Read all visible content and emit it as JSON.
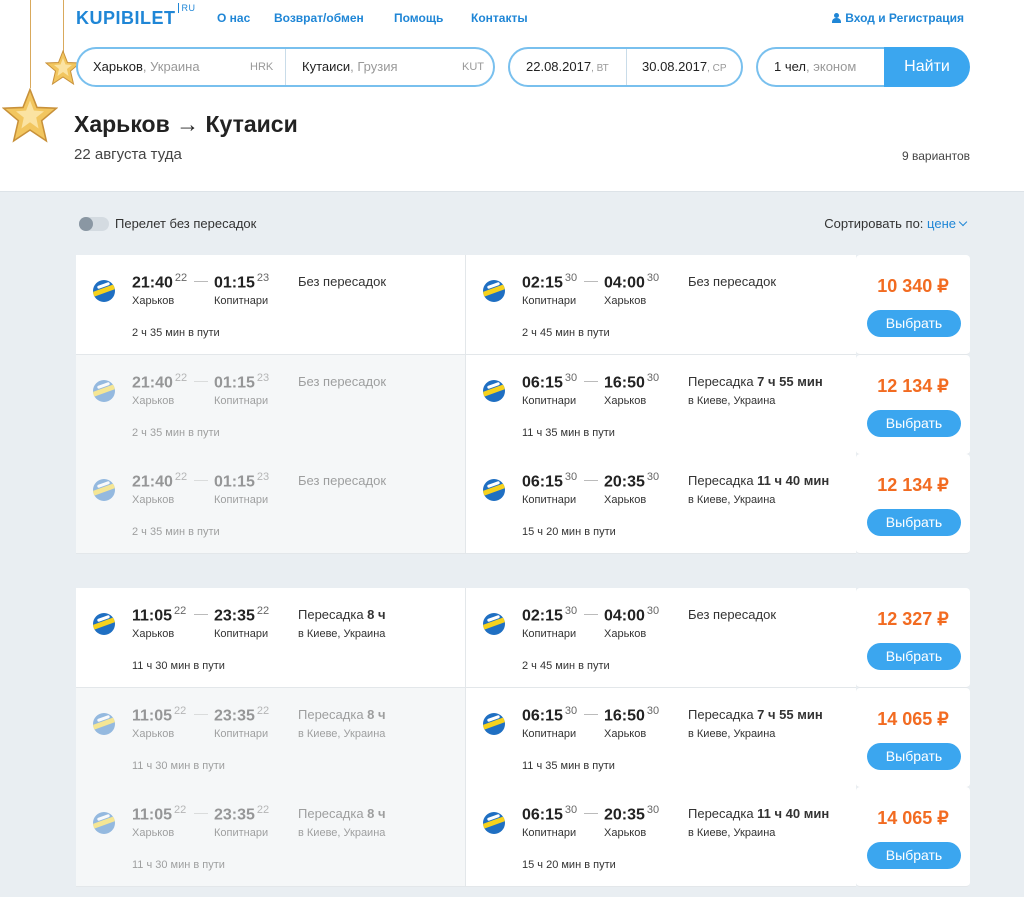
{
  "header": {
    "logo": "KUPIBILET",
    "logo_suffix": "RU",
    "nav": [
      "О нас",
      "Возврат/обмен",
      "Помощь",
      "Контакты"
    ],
    "login": "Вход и Регистрация"
  },
  "search": {
    "from_city": "Харьков",
    "from_country": ", Украина",
    "from_code": "HRK",
    "to_city": "Кутаиси",
    "to_country": ", Грузия",
    "to_code": "KUT",
    "depart_date": "22.08.2017",
    "depart_day": ", ВТ",
    "return_date": "30.08.2017",
    "return_day": ", СР",
    "passengers": "1 чел",
    "cabin": ", эконом",
    "find_label": "Найти"
  },
  "title": "Харьков → Кутаиси",
  "subtitle": "22 августа туда",
  "variants": "9 вариантов",
  "filters": {
    "nonstop_label": "Перелет без пересадок",
    "sort_label": "Сортировать по:",
    "sort_value": "цене"
  },
  "choose_label": "Выбрать",
  "colors": {
    "accent": "#3ba6ef",
    "price": "#f26b21",
    "brand": "#1f86d6"
  },
  "groups": [
    {
      "out": {
        "dep": "21:40",
        "dep_day": "22",
        "arr": "01:15",
        "arr_day": "23",
        "from": "Харьков",
        "to": "Копитнари",
        "change": "Без пересадок",
        "change_bold": "",
        "change_city": "",
        "dur": "2 ч 35 мин в пути"
      },
      "rows": [
        {
          "ret": {
            "dep": "02:15",
            "dep_day": "30",
            "arr": "04:00",
            "arr_day": "30",
            "from": "Копитнари",
            "to": "Харьков",
            "change": "Без пересадок",
            "change_bold": "",
            "change_city": "",
            "dur": "2 ч 45 мин в пути"
          },
          "price": "10 340 ₽"
        },
        {
          "ret": {
            "dep": "06:15",
            "dep_day": "30",
            "arr": "16:50",
            "arr_day": "30",
            "from": "Копитнари",
            "to": "Харьков",
            "change": "Пересадка ",
            "change_bold": "7 ч 55 мин",
            "change_city": "в Киеве, Украина",
            "dur": "11 ч 35 мин в пути"
          },
          "price": "12 134 ₽"
        },
        {
          "ret": {
            "dep": "06:15",
            "dep_day": "30",
            "arr": "20:35",
            "arr_day": "30",
            "from": "Копитнари",
            "to": "Харьков",
            "change": "Пересадка ",
            "change_bold": "11 ч 40 мин",
            "change_city": "в Киеве, Украина",
            "dur": "15 ч 20 мин в пути"
          },
          "price": "12 134 ₽"
        }
      ]
    },
    {
      "out": {
        "dep": "11:05",
        "dep_day": "22",
        "arr": "23:35",
        "arr_day": "22",
        "from": "Харьков",
        "to": "Копитнари",
        "change": "Пересадка ",
        "change_bold": "8 ч",
        "change_city": "в Киеве, Украина",
        "dur": "11 ч 30 мин в пути"
      },
      "rows": [
        {
          "ret": {
            "dep": "02:15",
            "dep_day": "30",
            "arr": "04:00",
            "arr_day": "30",
            "from": "Копитнари",
            "to": "Харьков",
            "change": "Без пересадок",
            "change_bold": "",
            "change_city": "",
            "dur": "2 ч 45 мин в пути"
          },
          "price": "12 327 ₽"
        },
        {
          "ret": {
            "dep": "06:15",
            "dep_day": "30",
            "arr": "16:50",
            "arr_day": "30",
            "from": "Копитнари",
            "to": "Харьков",
            "change": "Пересадка ",
            "change_bold": "7 ч 55 мин",
            "change_city": "в Киеве, Украина",
            "dur": "11 ч 35 мин в пути"
          },
          "price": "14 065 ₽"
        },
        {
          "ret": {
            "dep": "06:15",
            "dep_day": "30",
            "arr": "20:35",
            "arr_day": "30",
            "from": "Копитнари",
            "to": "Харьков",
            "change": "Пересадка ",
            "change_bold": "11 ч 40 мин",
            "change_city": "в Киеве, Украина",
            "dur": "15 ч 20 мин в пути"
          },
          "price": "14 065 ₽"
        }
      ]
    }
  ]
}
